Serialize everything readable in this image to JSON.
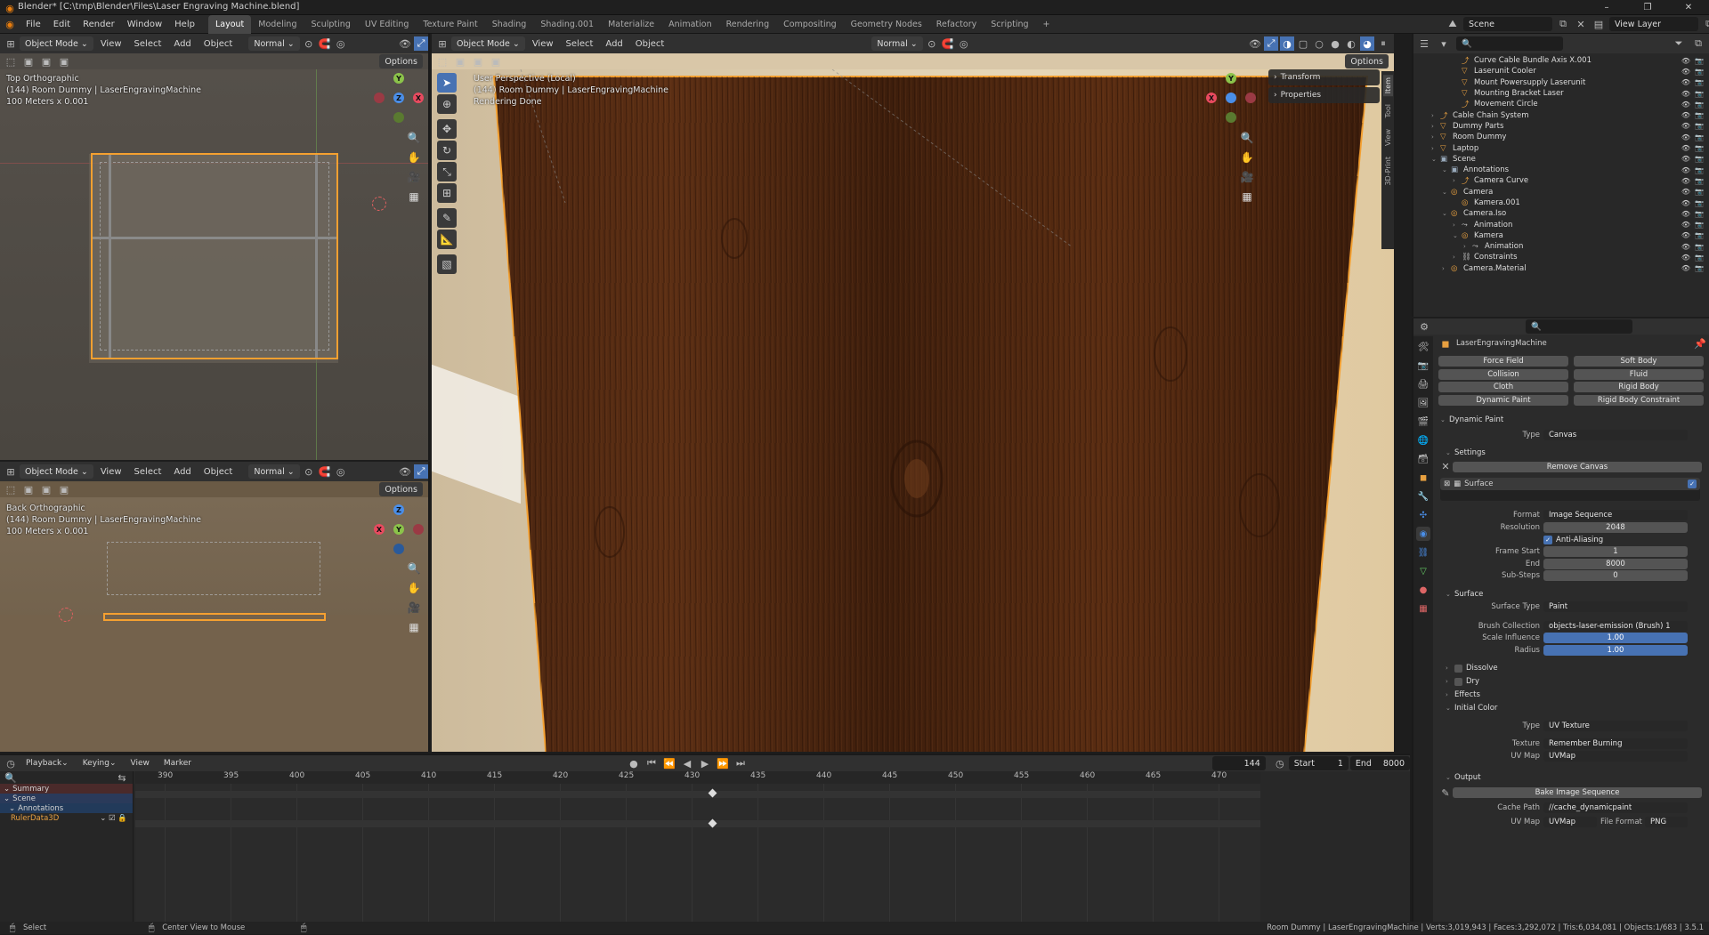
{
  "window": {
    "title": "Blender* [C:\\tmp\\Blender\\Files\\Laser Engraving Machine.blend]",
    "controls": [
      "–",
      "❐",
      "✕"
    ]
  },
  "menus": [
    "File",
    "Edit",
    "Render",
    "Window",
    "Help"
  ],
  "workspaces": [
    "Layout",
    "Modeling",
    "Sculpting",
    "UV Editing",
    "Texture Paint",
    "Shading",
    "Shading.001",
    "Materialize",
    "Animation",
    "Rendering",
    "Compositing",
    "Geometry Nodes",
    "Refactory",
    "Scripting",
    "+"
  ],
  "scene_selector": "Scene",
  "view_layer_selector": "View Layer",
  "vp_top": {
    "mode": "Object Mode",
    "menus": [
      "View",
      "Select",
      "Add",
      "Object"
    ],
    "orientation": "Normal",
    "options": "Options",
    "overlay_lines": [
      "Top Orthographic",
      "(144) Room Dummy | LaserEngravingMachine",
      "100 Meters x 0.001"
    ],
    "gizmo": {
      "y": "Y",
      "z": "Z",
      "x": "X"
    }
  },
  "vp_back": {
    "mode": "Object Mode",
    "menus": [
      "View",
      "Select",
      "Add",
      "Object"
    ],
    "orientation": "Normal",
    "options": "Options",
    "overlay_lines": [
      "Back Orthographic",
      "(144) Room Dummy | LaserEngravingMachine",
      "100 Meters x 0.001"
    ],
    "gizmo": {
      "z": "Z",
      "x": "X",
      "y": "Y"
    }
  },
  "vp_main": {
    "mode": "Object Mode",
    "menus": [
      "View",
      "Select",
      "Add",
      "Object"
    ],
    "orientation": "Normal",
    "options": "Options",
    "overlay_lines": [
      "User Perspective (Local)",
      "(144) Room Dummy | LaserEngravingMachine",
      "Rendering Done"
    ],
    "npanel": [
      "Transform",
      "Properties"
    ],
    "side_tabs": [
      "Item",
      "Tool",
      "View",
      "3D-Print"
    ],
    "gizmo": {
      "y": "Y",
      "x": "X"
    }
  },
  "outliner": {
    "rows": [
      {
        "indent": 3,
        "label": "Curve Cable Bundle Axis X.001",
        "icon": "curve"
      },
      {
        "indent": 3,
        "label": "Laserunit Cooler",
        "icon": "mesh"
      },
      {
        "indent": 3,
        "label": "Mount Powersupply Laserunit",
        "icon": "mesh"
      },
      {
        "indent": 3,
        "label": "Mounting Bracket Laser",
        "icon": "mesh"
      },
      {
        "indent": 3,
        "label": "Movement Circle",
        "icon": "curve"
      },
      {
        "indent": 1,
        "label": "Cable Chain System",
        "icon": "curve",
        "expand": "›"
      },
      {
        "indent": 1,
        "label": "Dummy Parts",
        "icon": "mesh",
        "expand": "›"
      },
      {
        "indent": 1,
        "label": "Room Dummy",
        "icon": "mesh",
        "expand": "›"
      },
      {
        "indent": 1,
        "label": "Laptop",
        "icon": "mesh",
        "expand": "›"
      },
      {
        "indent": 1,
        "label": "Scene",
        "icon": "scene",
        "expand": "⌄"
      },
      {
        "indent": 2,
        "label": "Annotations",
        "icon": "scene",
        "expand": "⌄"
      },
      {
        "indent": 3,
        "label": "Camera Curve",
        "icon": "curve",
        "expand": "›"
      },
      {
        "indent": 2,
        "label": "Camera",
        "icon": "cam",
        "expand": "⌄"
      },
      {
        "indent": 3,
        "label": "Kamera.001",
        "icon": "cam"
      },
      {
        "indent": 2,
        "label": "Camera.Iso",
        "icon": "cam",
        "expand": "⌄"
      },
      {
        "indent": 3,
        "label": "Animation",
        "icon": "anim",
        "expand": "›"
      },
      {
        "indent": 3,
        "label": "Kamera",
        "icon": "cam",
        "expand": "⌄"
      },
      {
        "indent": 4,
        "label": "Animation",
        "icon": "anim",
        "expand": "›"
      },
      {
        "indent": 3,
        "label": "Constraints",
        "icon": "cons",
        "expand": "›"
      },
      {
        "indent": 2,
        "label": "Camera.Material",
        "icon": "cam",
        "expand": "›"
      }
    ]
  },
  "properties": {
    "object_name": "LaserEngravingMachine",
    "physics_buttons": [
      [
        "Force Field",
        "Soft Body"
      ],
      [
        "Collision",
        "Fluid"
      ],
      [
        "Cloth",
        "Rigid Body"
      ],
      [
        "Dynamic Paint",
        "Rigid Body Constraint"
      ]
    ],
    "dynamic_paint_header": "Dynamic Paint",
    "type_label": "Type",
    "type_value": "Canvas",
    "settings_header": "Settings",
    "remove_canvas": "Remove Canvas",
    "surface_item": "Surface",
    "format_label": "Format",
    "format_value": "Image Sequence",
    "resolution_label": "Resolution",
    "resolution_value": "2048",
    "antialias_label": "Anti-Aliasing",
    "frame_start_label": "Frame Start",
    "frame_start_value": "1",
    "end_label": "End",
    "end_value": "8000",
    "substeps_label": "Sub-Steps",
    "substeps_value": "0",
    "surface_header": "Surface",
    "surface_type_label": "Surface Type",
    "surface_type_value": "Paint",
    "brush_collection_label": "Brush Collection",
    "brush_collection_value": "objects-laser-emission (Brush) 1",
    "scale_influence_label": "Scale Influence",
    "scale_influence_value": "1.00",
    "radius_label": "Radius",
    "radius_value": "1.00",
    "dissolve_header": "Dissolve",
    "dry_header": "Dry",
    "effects_header": "Effects",
    "initial_color_header": "Initial Color",
    "ic_type_label": "Type",
    "ic_type_value": "UV Texture",
    "texture_label": "Texture",
    "texture_value": "Remember Burning",
    "uvmap_label": "UV Map",
    "uvmap_value": "UVMap",
    "output_header": "Output",
    "bake_button": "Bake Image Sequence",
    "cache_path_label": "Cache Path",
    "cache_path_value": "//cache_dynamicpaint",
    "uvmap_label2": "UV Map",
    "uvmap_value2": "UVMap",
    "file_format_label": "File Format",
    "file_format_value": "PNG"
  },
  "timeline": {
    "menus": [
      "Playback",
      "Keying",
      "View",
      "Marker"
    ],
    "current_frame": "144",
    "start_label": "Start",
    "start_value": "1",
    "end_label": "End",
    "end_value": "8000",
    "ticks": [
      "390",
      "395",
      "400",
      "405",
      "410",
      "415",
      "420",
      "425",
      "430",
      "435",
      "440",
      "445",
      "450",
      "455",
      "460",
      "465",
      "470"
    ],
    "channels": [
      "Summary",
      "Scene",
      "Annotations",
      "RulerData3D"
    ]
  },
  "status": {
    "left": "Select",
    "middle": "Center View to Mouse",
    "right": "Room Dummy | LaserEngravingMachine | Verts:3,019,943 | Faces:3,292,072 | Tris:6,034,081 | Objects:1/683 | 3.5.1"
  },
  "colors": {
    "accent": "#4772b3",
    "selection_orange": "#f5a030",
    "wood_dark": "#3a1d0e",
    "wood_mid": "#5a2e14"
  }
}
